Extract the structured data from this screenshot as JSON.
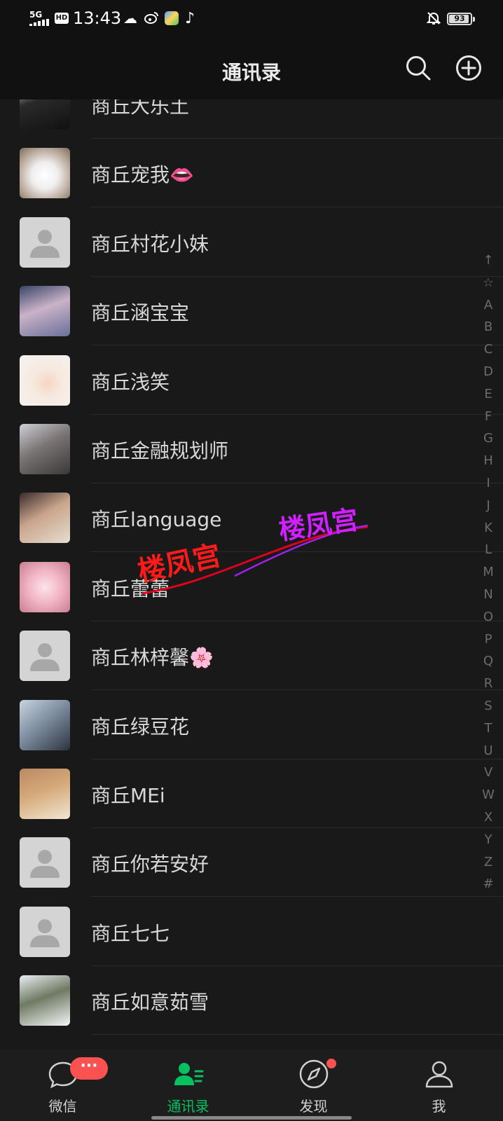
{
  "status_bar": {
    "network": "5G",
    "hd": "HD",
    "time": "13:43",
    "battery": "93",
    "battery_fraction": 0.93
  },
  "header": {
    "title": "通讯录",
    "search_icon": "search-icon",
    "add_icon": "add-circle-icon"
  },
  "contacts": [
    {
      "name": "商丘大乐土",
      "avatar": "photo"
    },
    {
      "name": "商丘宠我👄",
      "avatar": "photo"
    },
    {
      "name": "商丘村花小妹",
      "avatar": "default"
    },
    {
      "name": "商丘涵宝宝",
      "avatar": "photo"
    },
    {
      "name": "商丘浅笑",
      "avatar": "photo"
    },
    {
      "name": "商丘金融规划师",
      "avatar": "photo"
    },
    {
      "name": "商丘language",
      "avatar": "photo"
    },
    {
      "name": "商丘蕾蕾",
      "avatar": "photo"
    },
    {
      "name": "商丘林梓馨🌸",
      "avatar": "default"
    },
    {
      "name": "商丘绿豆花",
      "avatar": "photo"
    },
    {
      "name": "商丘MEi",
      "avatar": "photo"
    },
    {
      "name": "商丘你若安好",
      "avatar": "default"
    },
    {
      "name": "商丘七七",
      "avatar": "default"
    },
    {
      "name": "商丘如意茹雪",
      "avatar": "photo"
    }
  ],
  "index_bar": [
    "↑",
    "☆",
    "A",
    "B",
    "C",
    "D",
    "E",
    "F",
    "G",
    "H",
    "I",
    "J",
    "K",
    "L",
    "M",
    "N",
    "O",
    "P",
    "Q",
    "R",
    "S",
    "T",
    "U",
    "V",
    "W",
    "X",
    "Y",
    "Z",
    "#"
  ],
  "watermark": {
    "text_left": "楼凤宫",
    "text_right": "楼凤宫"
  },
  "tab_bar": {
    "tabs": [
      {
        "label": "微信",
        "icon": "chat-bubble-icon",
        "badge": "···"
      },
      {
        "label": "通讯录",
        "icon": "contacts-icon",
        "active": true
      },
      {
        "label": "发现",
        "icon": "compass-icon",
        "dot": true
      },
      {
        "label": "我",
        "icon": "person-icon"
      }
    ]
  },
  "colors": {
    "background": "#191919",
    "bar": "#111111",
    "accent": "#07c160",
    "badge": "#fa5151"
  }
}
